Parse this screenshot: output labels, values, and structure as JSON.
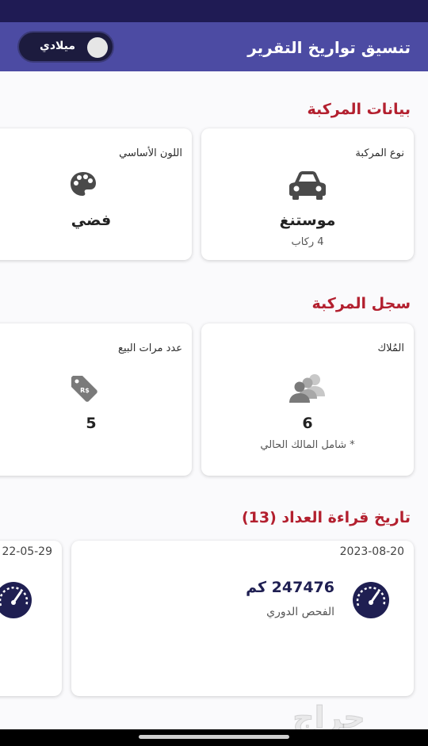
{
  "appbar": {
    "title": "تنسيق تواريخ التقرير",
    "toggle_label": "ميلادي"
  },
  "vehicle_data": {
    "title": "بيانات المركبة",
    "type_card": {
      "label": "نوع المركبة",
      "icon": "car-icon",
      "value": "موستنغ",
      "sub": "4 ركاب"
    },
    "color_card": {
      "label": "اللون الأساسي",
      "icon": "palette-icon",
      "value": "فضي"
    }
  },
  "vehicle_history": {
    "title": "سجل المركبة",
    "owners_card": {
      "label": "المُلاك",
      "icon": "owners-icon",
      "value": "6",
      "sub": "* شامل المالك الحالي"
    },
    "sales_card": {
      "label": "عدد مرات البيع",
      "icon": "price-tag-icon",
      "value": "5"
    }
  },
  "odometer": {
    "title": "تاريخ قراءة العداد (13)",
    "readings": [
      {
        "date": "2023-08-20",
        "value": "247476 كم",
        "type": "الفحص الدوري",
        "icon": "speedometer-icon"
      },
      {
        "date": "22-05-29",
        "icon": "speedometer-icon"
      }
    ]
  },
  "watermark": {
    "text": "حراج"
  },
  "colors": {
    "appbar": "#4c4ba3",
    "statusbar": "#1f1b54",
    "accent": "#b3202f",
    "icon_dark": "#1f1f52"
  }
}
